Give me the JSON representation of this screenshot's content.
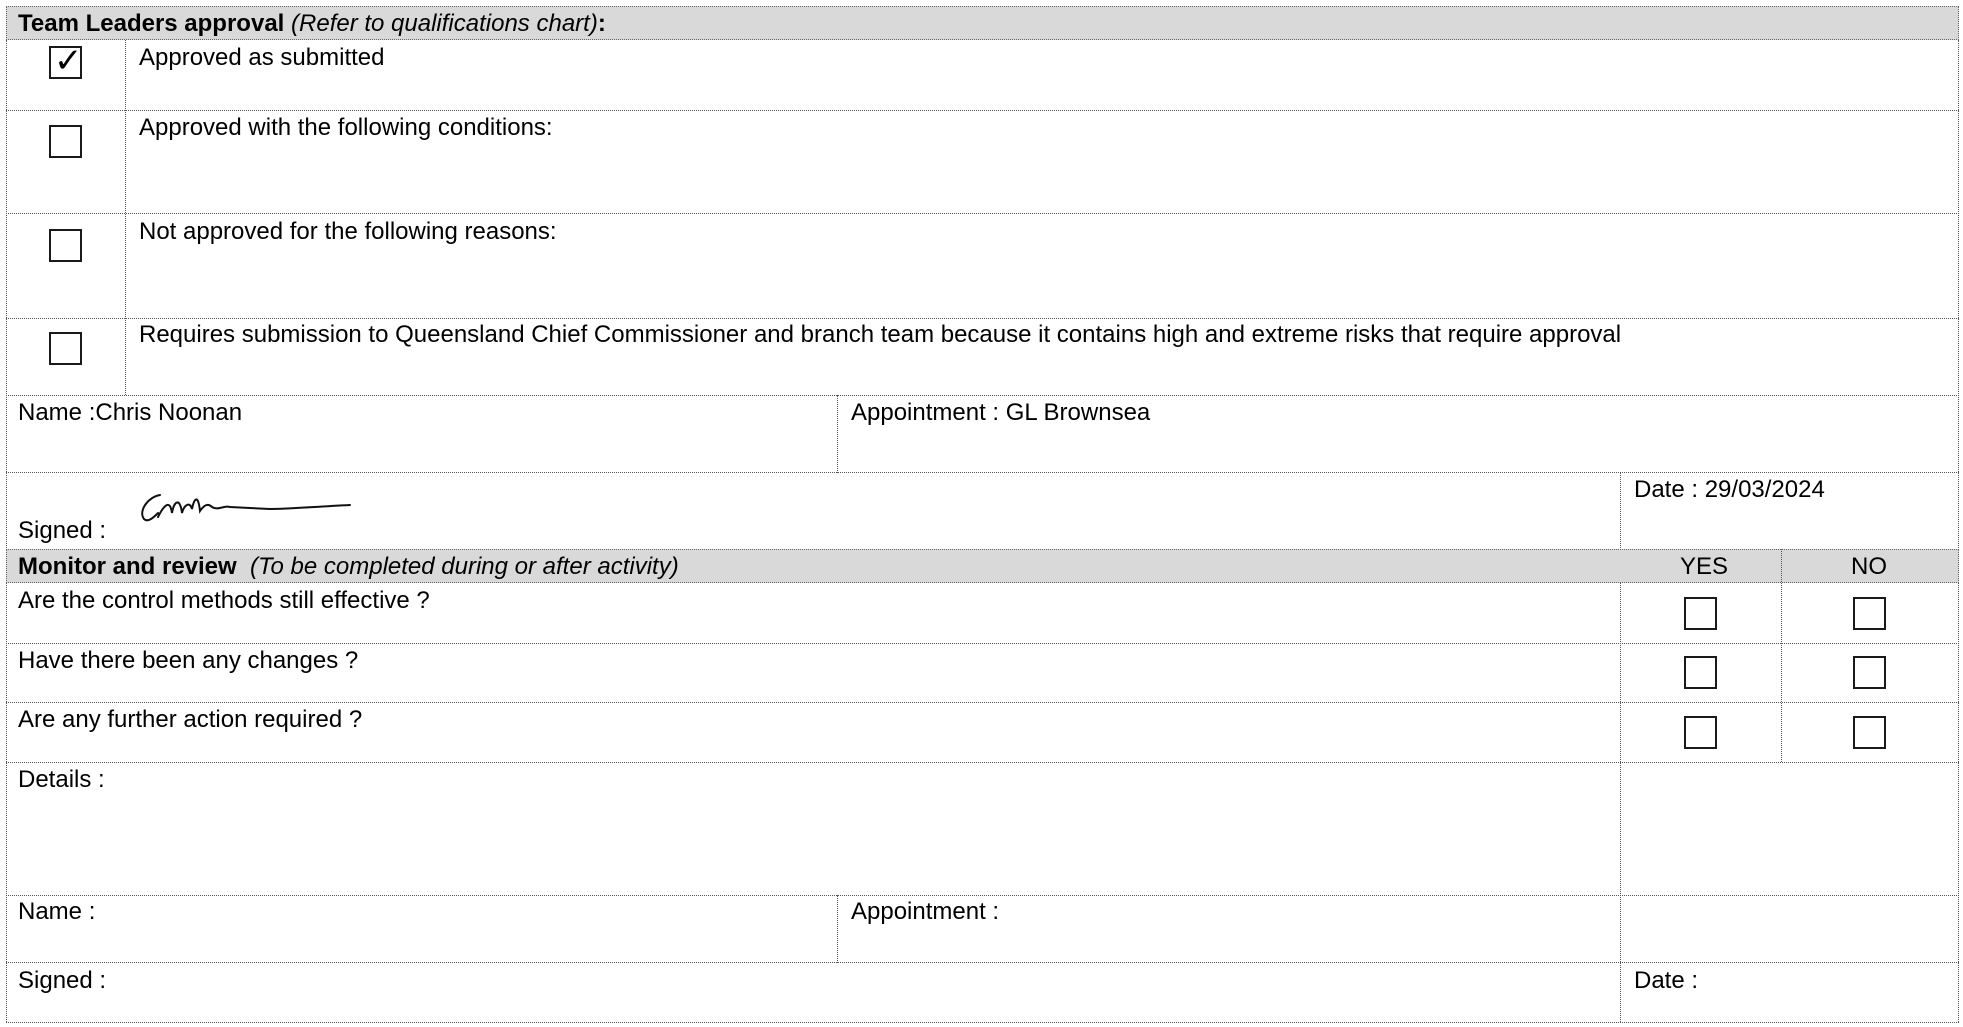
{
  "approval": {
    "heading": "Team Leaders approval",
    "heading_note": "(Refer to qualifications chart)",
    "heading_colon": ":",
    "options": [
      {
        "label": "Approved as submitted",
        "checked": true
      },
      {
        "label": "Approved with the following conditions:",
        "checked": false
      },
      {
        "label": "Not approved for the following reasons:",
        "checked": false
      },
      {
        "label": "Requires submission to Queensland Chief Commissioner and branch team  because it contains high and extreme risks that require approval",
        "checked": false
      }
    ],
    "name_label": "Name :Chris Noonan",
    "appointment_label": "Appointment : GL Brownsea",
    "signed_label": "Signed :",
    "date_label": "Date : 29/03/2024",
    "signature_text": "CNoonan"
  },
  "monitor": {
    "heading": "Monitor and review",
    "heading_note": "(To be completed during or after activity)",
    "yes_label": "YES",
    "no_label": "NO",
    "questions": [
      "Are the control methods still effective ?",
      "Have there been any changes ?",
      "Are any further action required ?"
    ],
    "details_label": "Details :",
    "name_label": "Name :",
    "appointment_label": "Appointment :",
    "signed_label": "Signed :",
    "date_label": "Date :"
  }
}
